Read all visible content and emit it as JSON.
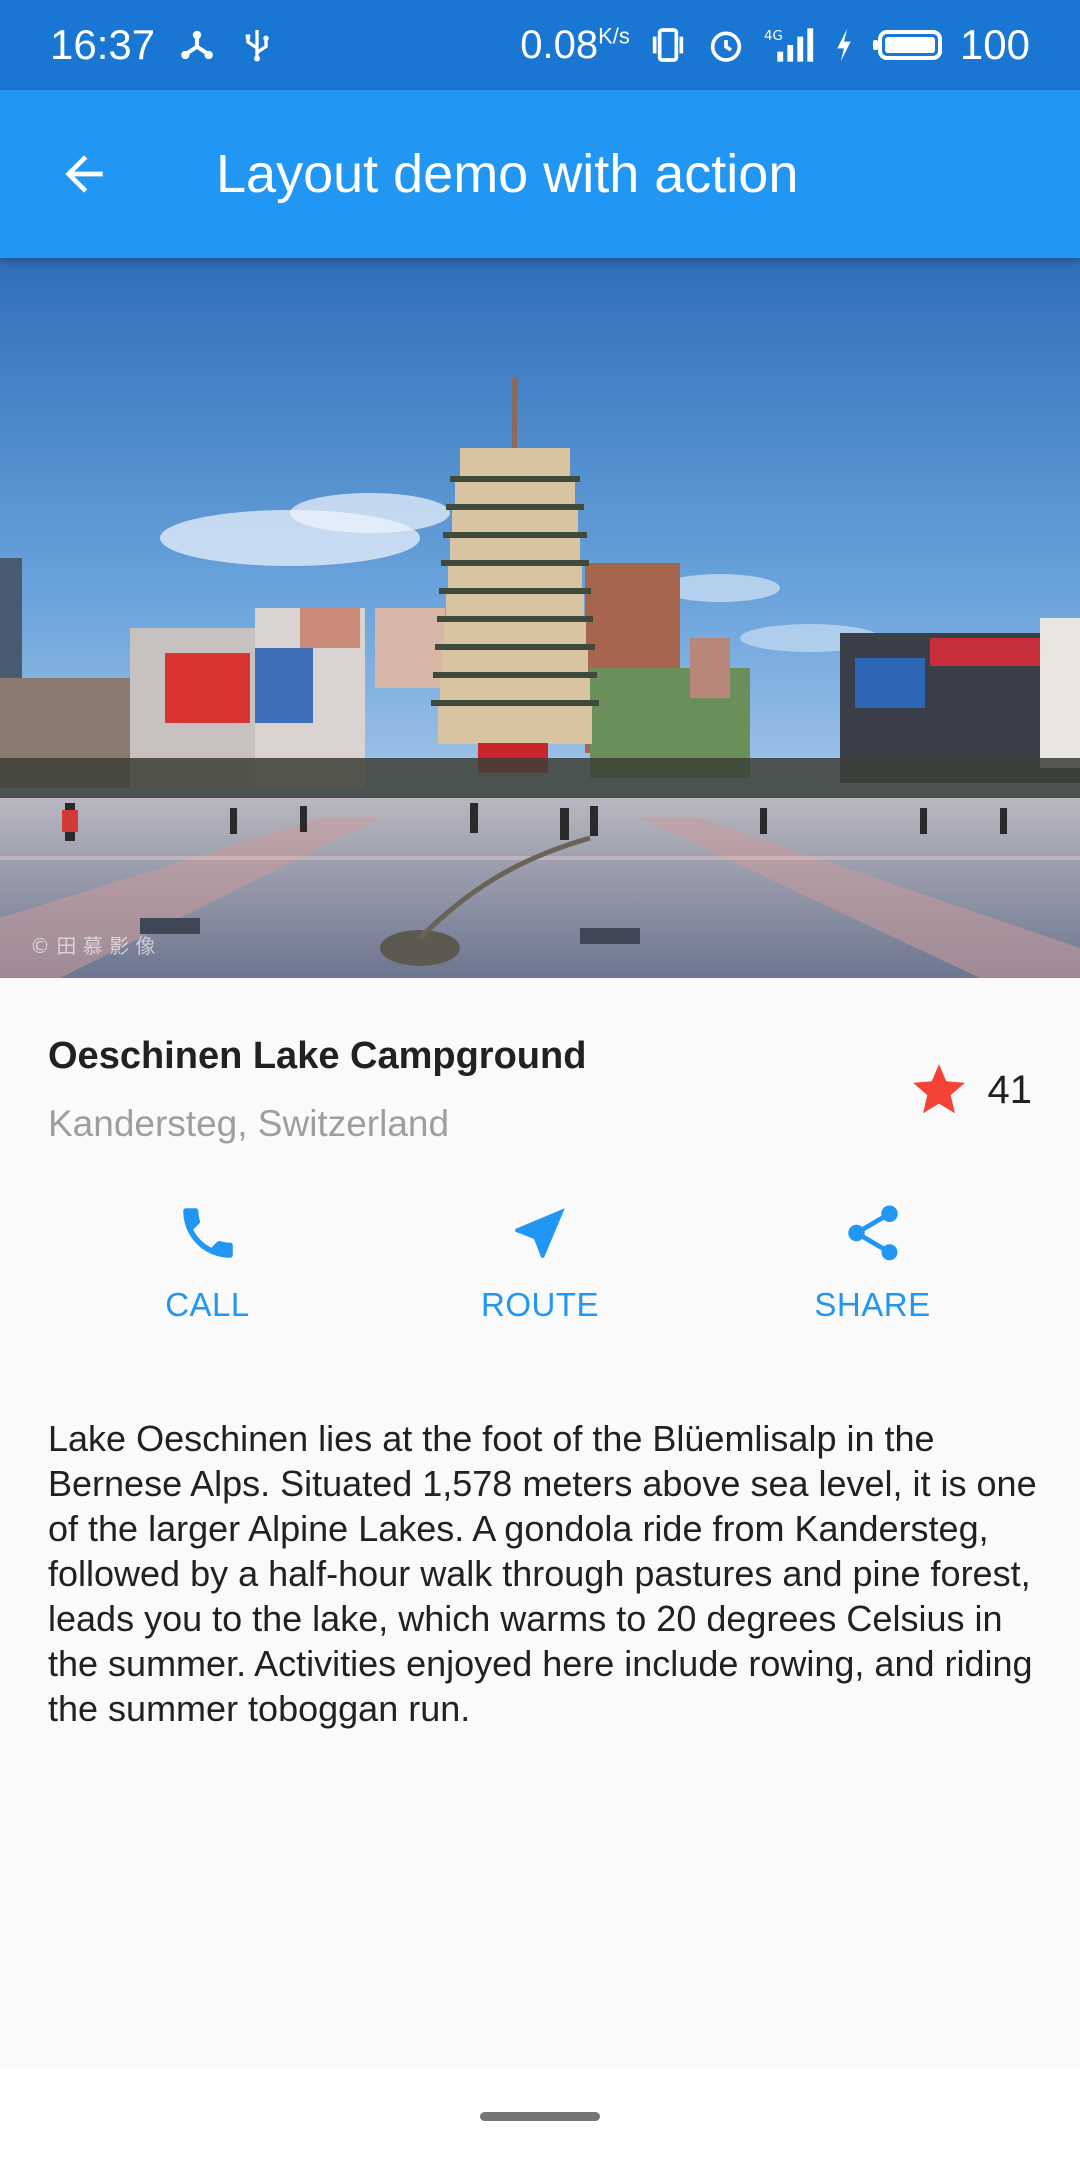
{
  "status_bar": {
    "time": "16:37",
    "speed_value": "0.08",
    "speed_unit": "K/s",
    "network": "4G",
    "battery": "100"
  },
  "app_bar": {
    "title": "Layout demo with action",
    "back_icon": "arrow-back-icon"
  },
  "hero": {
    "watermark": "© 田 慕 影 像"
  },
  "place": {
    "name": "Oeschinen Lake Campground",
    "location": "Kandersteg, Switzerland",
    "rating_icon": "star-icon",
    "rating_count": "41"
  },
  "actions": [
    {
      "label": "CALL",
      "icon": "phone-icon"
    },
    {
      "label": "ROUTE",
      "icon": "navigation-icon"
    },
    {
      "label": "SHARE",
      "icon": "share-icon"
    }
  ],
  "description": "Lake Oeschinen lies at the foot of the Blüemlisalp in the Bernese Alps. Situated 1,578 meters above sea level, it is one of the larger Alpine Lakes. A gondola ride from Kandersteg, followed by a half-hour walk through pastures and pine forest, leads you to the lake, which warms to 20 degrees Celsius in the summer. Activities enjoyed here include rowing, and riding the summer toboggan run.",
  "colors": {
    "primary": "#2196f3",
    "primary_dark": "#1976d2",
    "star": "#f44336"
  }
}
